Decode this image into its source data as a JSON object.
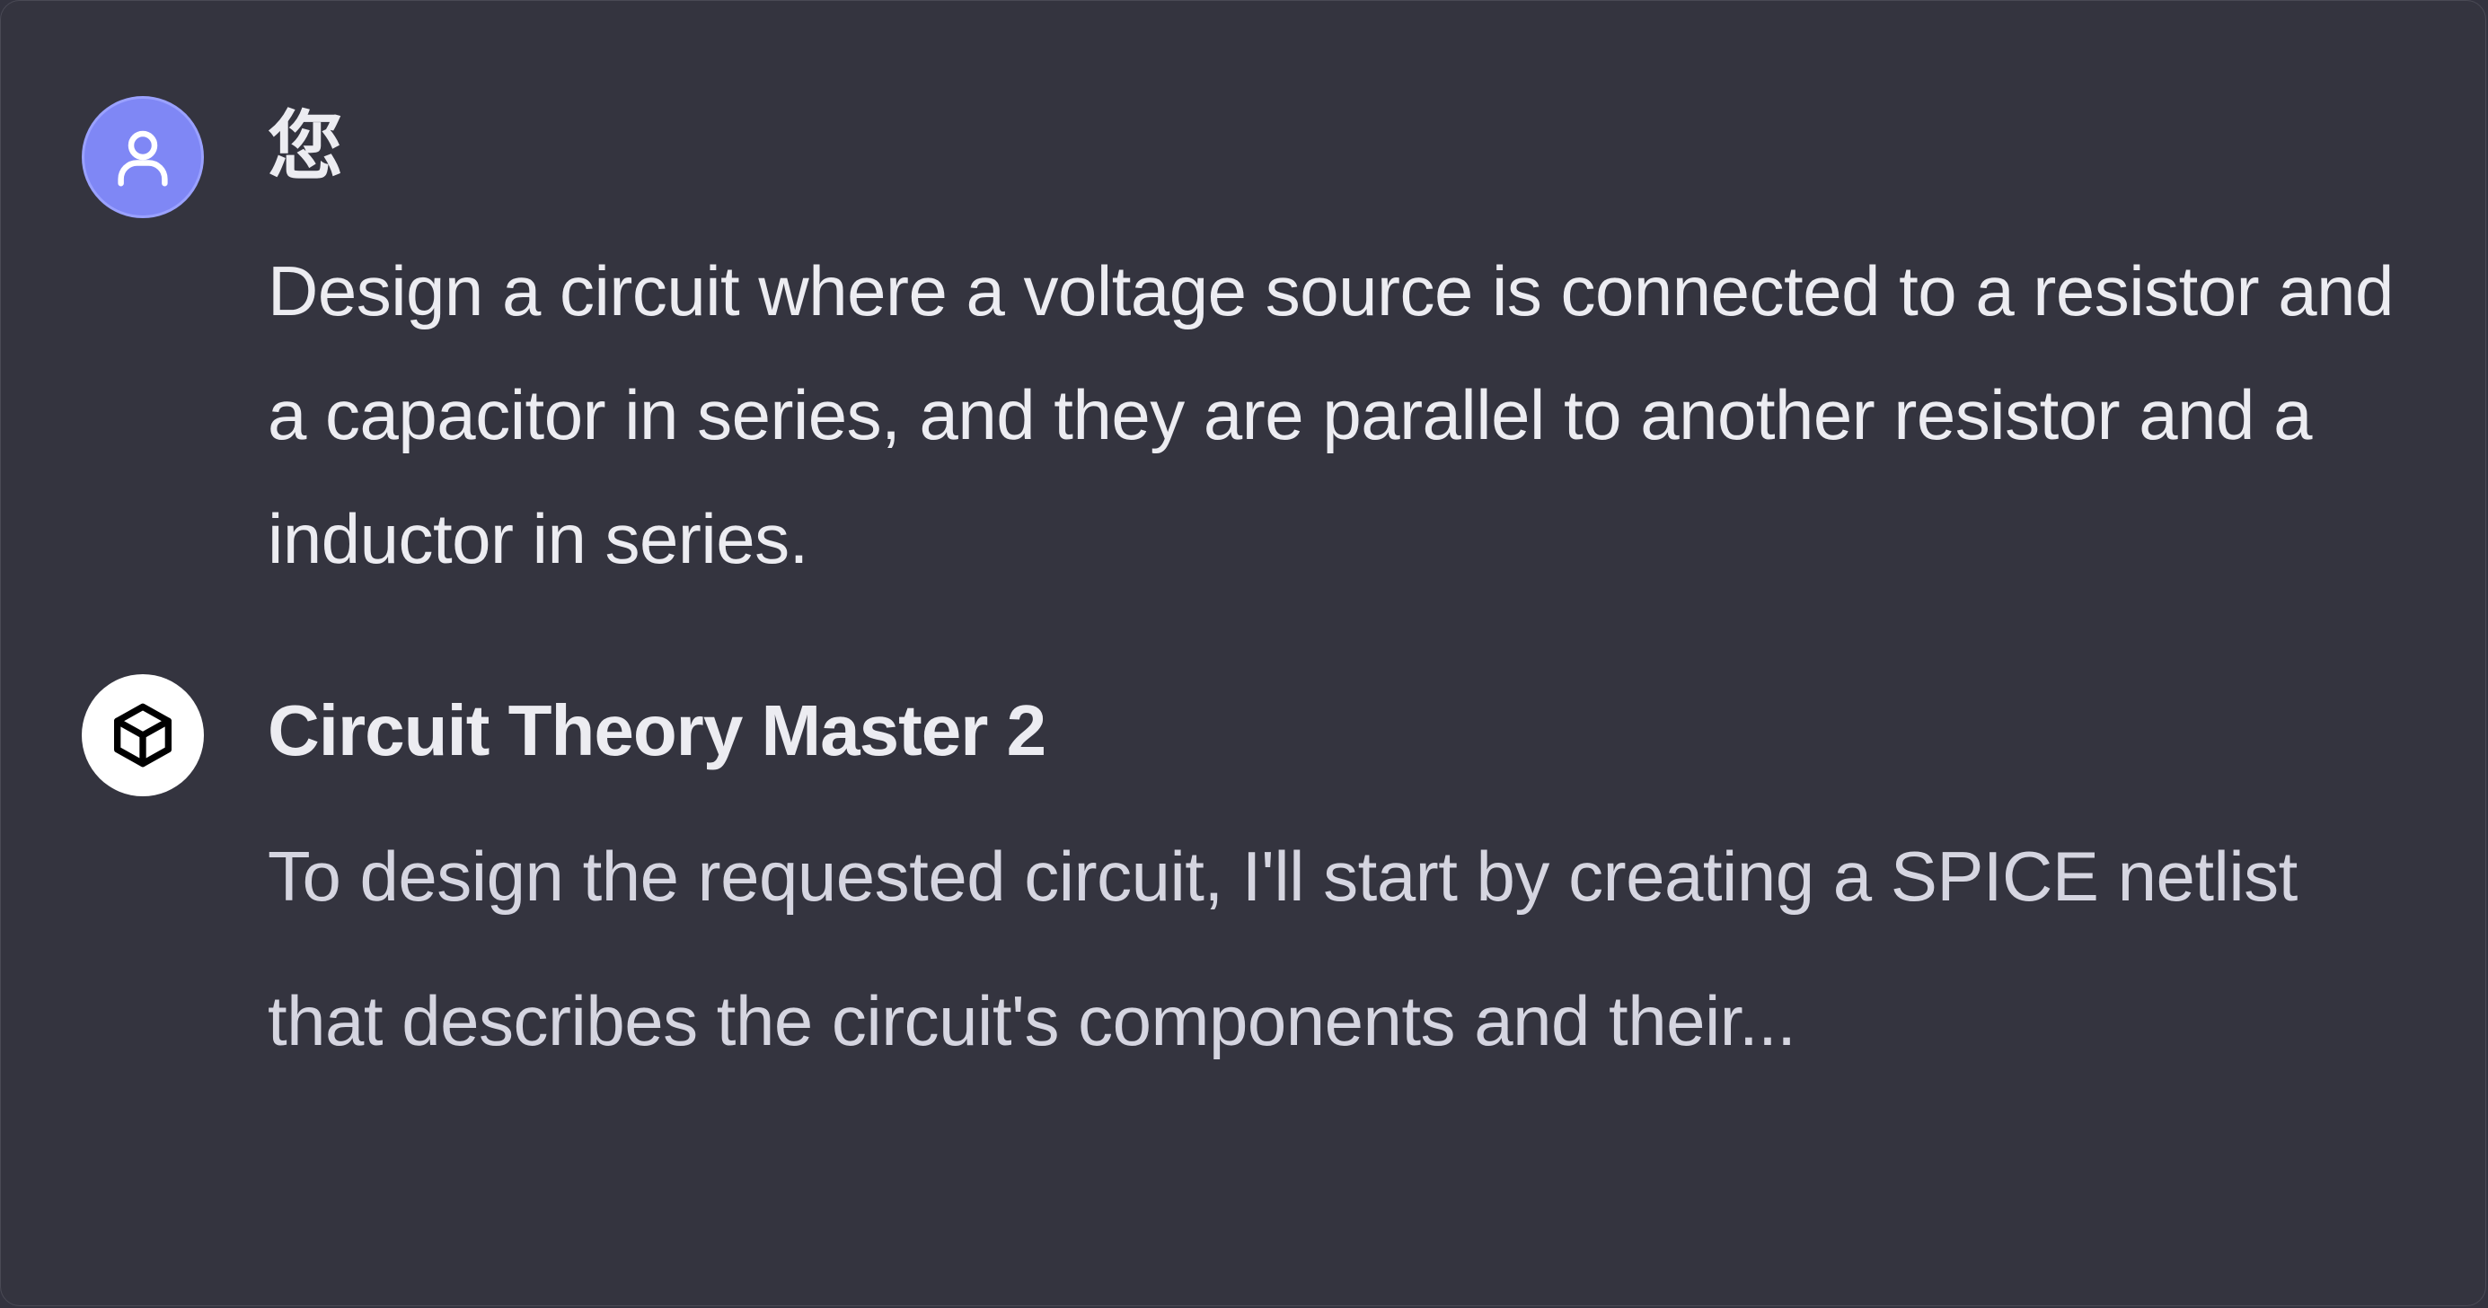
{
  "conversation": {
    "messages": [
      {
        "role": "user",
        "author": "您",
        "avatar_icon": "user-icon",
        "avatar_color": "#7f87f5",
        "text": "Design a circuit where a voltage source is connected to a resistor and a capacitor in series, and they are parallel to another resistor and a inductor in series."
      },
      {
        "role": "assistant",
        "author": "Circuit Theory Master 2",
        "avatar_icon": "cube-icon",
        "avatar_color": "#ffffff",
        "text": "To design the requested circuit, I'll start by creating a SPICE netlist that describes the circuit's components and their..."
      }
    ]
  },
  "colors": {
    "background": "#34343f",
    "text_primary": "#ececf1",
    "text_secondary": "#d5d5e0"
  }
}
